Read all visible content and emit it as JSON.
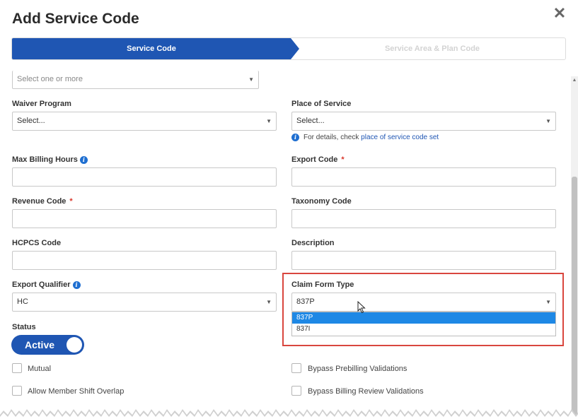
{
  "modal": {
    "title": "Add Service Code",
    "close_icon": "close-icon"
  },
  "stepper": {
    "steps": [
      {
        "label": "Service Code",
        "state": "active"
      },
      {
        "label": "Service Area & Plan Code",
        "state": "inactive"
      }
    ]
  },
  "colors": {
    "primary": "#1f56b3",
    "required": "#d9372b",
    "highlight": "#d9463e",
    "selected_option": "#1e88e5"
  },
  "top_select": {
    "placeholder": "Select one or more"
  },
  "waiver_program": {
    "label": "Waiver Program",
    "value": "Select..."
  },
  "place_of_service": {
    "label": "Place of Service",
    "value": "Select...",
    "help_prefix": "For details, check",
    "help_link": "place of service code set"
  },
  "max_billing_hours": {
    "label": "Max Billing Hours",
    "value": ""
  },
  "export_code": {
    "label": "Export Code",
    "required_mark": "*",
    "value": ""
  },
  "revenue_code": {
    "label": "Revenue Code",
    "required_mark": "*",
    "value": ""
  },
  "taxonomy_code": {
    "label": "Taxonomy Code",
    "value": ""
  },
  "hcpcs_code": {
    "label": "HCPCS Code",
    "value": ""
  },
  "description": {
    "label": "Description",
    "value": ""
  },
  "export_qualifier": {
    "label": "Export Qualifier",
    "value": "HC"
  },
  "claim_form_type": {
    "label": "Claim Form Type",
    "value": "837P",
    "options": [
      {
        "label": "837P",
        "selected": true
      },
      {
        "label": "837I",
        "selected": false
      }
    ]
  },
  "status": {
    "label": "Status",
    "toggle_label": "Active",
    "on": true
  },
  "checkboxes": {
    "mutual": "Mutual",
    "allow_member_shift_overlap": "Allow Member Shift Overlap",
    "bypass_prebilling": "Bypass Prebilling Validations",
    "bypass_billing_review": "Bypass Billing Review Validations"
  }
}
